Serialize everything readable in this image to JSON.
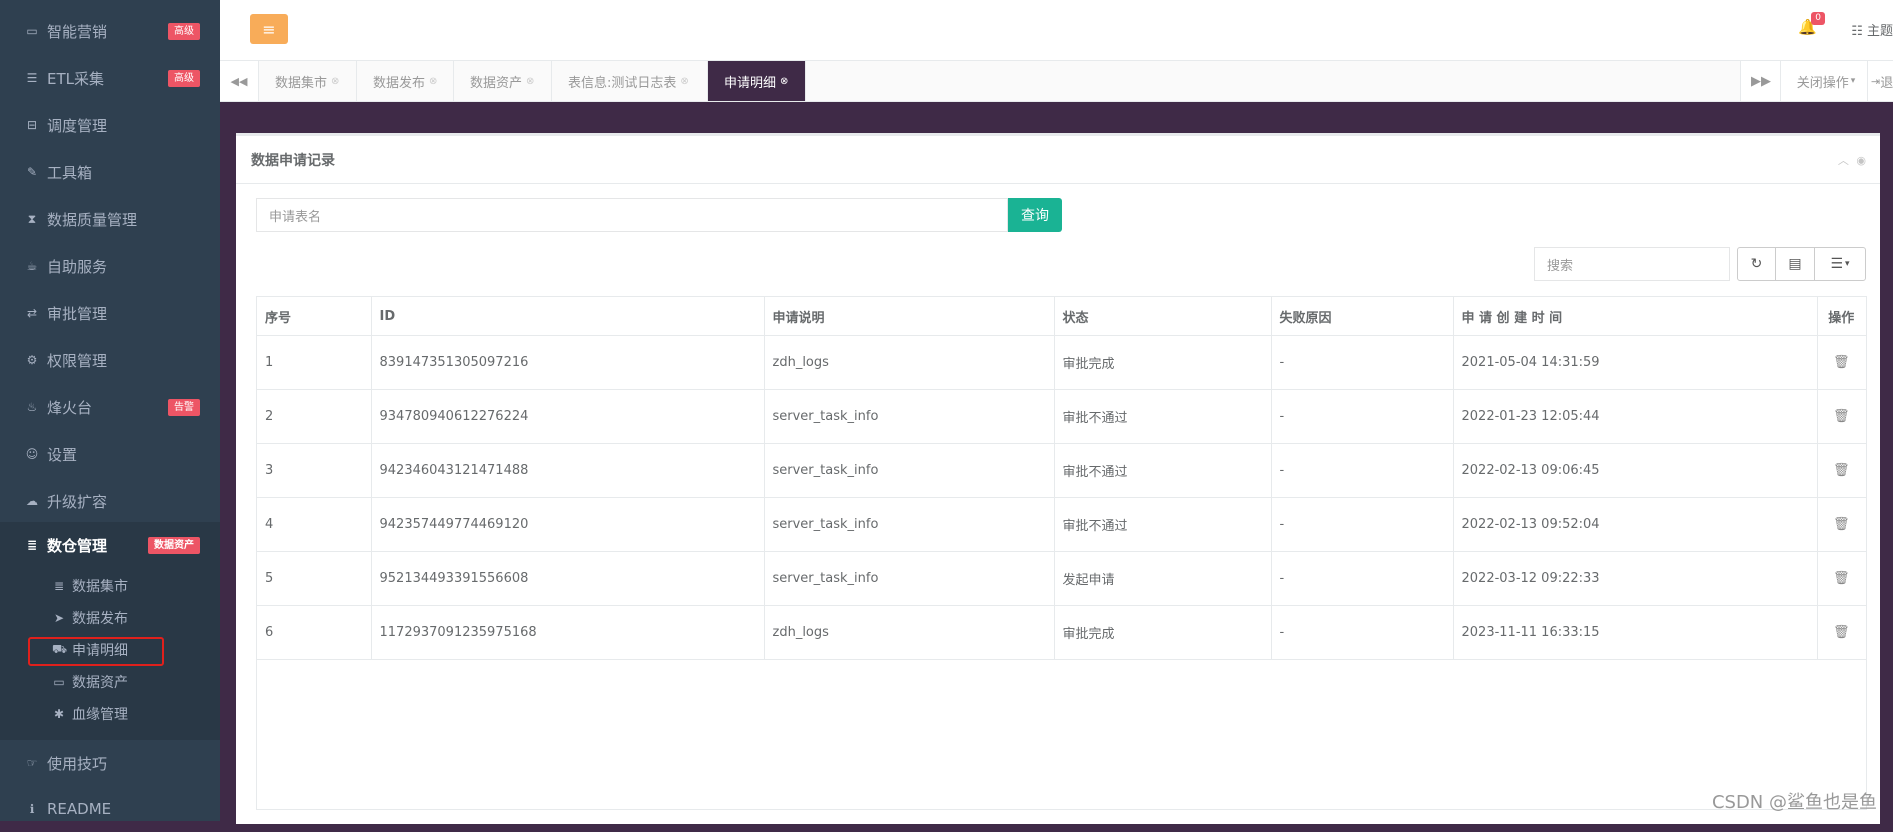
{
  "sidebar": {
    "items": [
      {
        "icon": "computer-icon",
        "glyph": "▭",
        "label": "智能营销",
        "badge": "高级"
      },
      {
        "icon": "list-icon",
        "glyph": "☰",
        "label": "ETL采集",
        "badge": "高级"
      },
      {
        "icon": "bus-icon",
        "glyph": "⊟",
        "label": "调度管理",
        "badge": ""
      },
      {
        "icon": "wrench-icon",
        "glyph": "✎",
        "label": "工具箱",
        "badge": ""
      },
      {
        "icon": "hourglass-icon",
        "glyph": "⧗",
        "label": "数据质量管理",
        "badge": ""
      },
      {
        "icon": "coffee-icon",
        "glyph": "☕",
        "label": "自助服务",
        "badge": ""
      },
      {
        "icon": "exchange-icon",
        "glyph": "⇄",
        "label": "审批管理",
        "badge": ""
      },
      {
        "icon": "gear-icon",
        "glyph": "⚙",
        "label": "权限管理",
        "badge": ""
      },
      {
        "icon": "fire-icon",
        "glyph": "♨",
        "label": "烽火台",
        "badge": "告警"
      },
      {
        "icon": "user-icon",
        "glyph": "☺",
        "label": "设置",
        "badge": ""
      },
      {
        "icon": "cloud-icon",
        "glyph": "☁",
        "label": "升级扩容",
        "badge": ""
      }
    ],
    "active_group": {
      "icon": "database-icon",
      "glyph": "≣",
      "label": "数仓管理",
      "badge": "数据资产"
    },
    "sub_items": [
      {
        "icon": "database-icon",
        "glyph": "≣",
        "label": "数据集市"
      },
      {
        "icon": "send-icon",
        "glyph": "➤",
        "label": "数据发布"
      },
      {
        "icon": "truck-icon",
        "glyph": "⛟",
        "label": "申请明细"
      },
      {
        "icon": "laptop-icon",
        "glyph": "▭",
        "label": "数据资产"
      },
      {
        "icon": "asterisk-icon",
        "glyph": "✱",
        "label": "血缘管理"
      }
    ],
    "bottom_items": [
      {
        "icon": "hand-icon",
        "glyph": "☞",
        "label": "使用技巧"
      },
      {
        "icon": "info-icon",
        "glyph": "ℹ",
        "label": "README"
      }
    ]
  },
  "header": {
    "menu_toggle_glyph": "≡",
    "notification_count": "0",
    "theme_label": "主题"
  },
  "tabs": {
    "items": [
      "数据集市",
      "数据发布",
      "数据资产",
      "表信息:测试日志表",
      "申请明细"
    ],
    "active_index": 4,
    "close_menu_label": "关闭操作",
    "exit_label": "退"
  },
  "panel": {
    "title": "数据申请记录",
    "search_placeholder": "申请表名",
    "search_button": "查询",
    "table_search_placeholder": "搜索"
  },
  "table": {
    "columns": [
      "序号",
      "ID",
      "申请说明",
      "状态",
      "失败原因",
      "申 请 创 建 时 间",
      "操作"
    ],
    "rows": [
      [
        "1",
        "839147351305097216",
        "zdh_logs",
        "审批完成",
        "-",
        "2021-05-04 14:31:59"
      ],
      [
        "2",
        "934780940612276224",
        "server_task_info",
        "审批不通过",
        "-",
        "2022-01-23 12:05:44"
      ],
      [
        "3",
        "942346043121471488",
        "server_task_info",
        "审批不通过",
        "-",
        "2022-02-13 09:06:45"
      ],
      [
        "4",
        "942357449774469120",
        "server_task_info",
        "审批不通过",
        "-",
        "2022-02-13 09:52:04"
      ],
      [
        "5",
        "952134493391556608",
        "server_task_info",
        "发起申请",
        "-",
        "2022-03-12 09:22:33"
      ],
      [
        "6",
        "1172937091235975168",
        "zdh_logs",
        "审批完成",
        "-",
        "2023-11-11 16:33:15"
      ]
    ]
  },
  "watermark": "CSDN @鲨鱼也是鱼",
  "colors": {
    "sidebar_bg": "#2f4050",
    "content_bg": "#3f2a47",
    "badge_red": "#ed5565",
    "toggle_orange": "#f8ac59",
    "query_green": "#1ab394",
    "highlight_red": "#e0201c"
  }
}
